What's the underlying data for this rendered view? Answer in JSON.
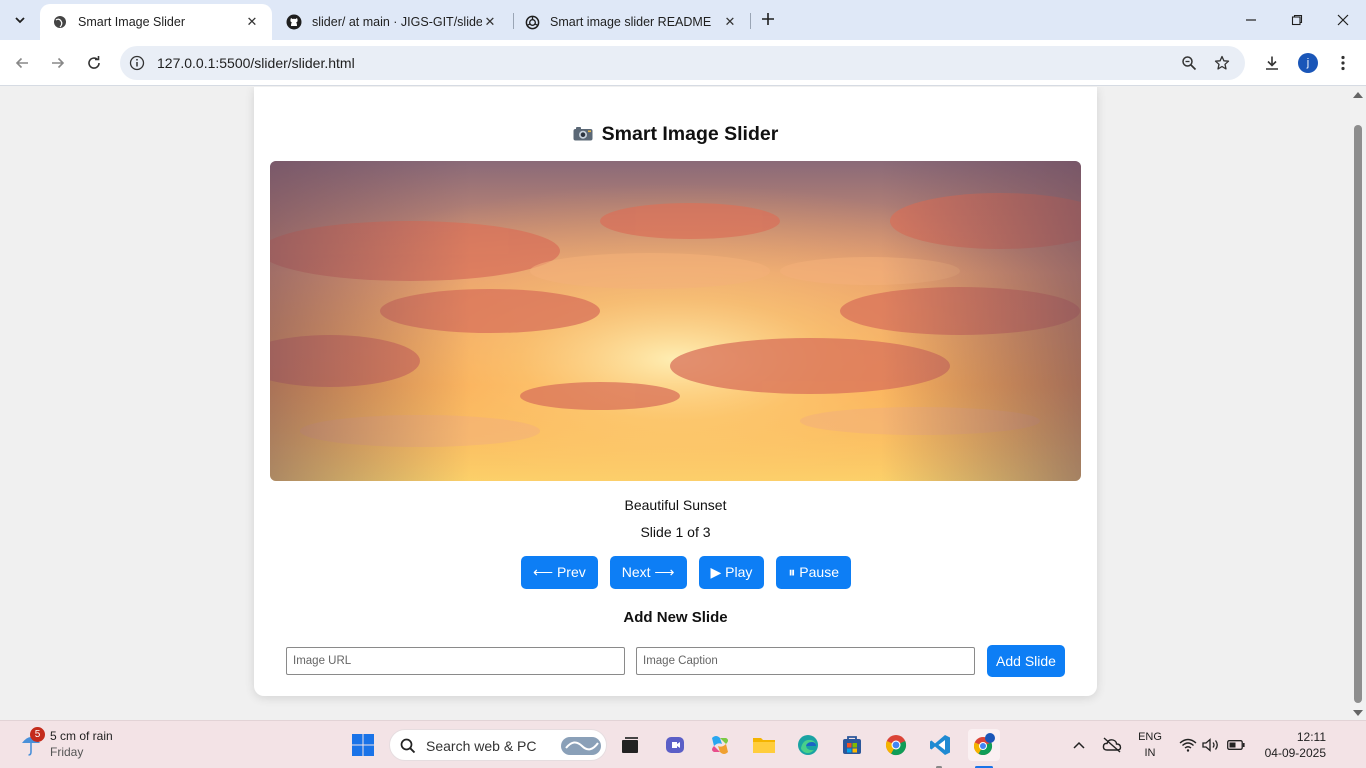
{
  "browser": {
    "tabs": [
      {
        "title": "Smart Image Slider",
        "active": true,
        "icon": "globe-icon"
      },
      {
        "title": "slider/ at main · JIGS-GIT/slider",
        "active": false,
        "icon": "github-icon"
      },
      {
        "title": "Smart image slider README",
        "active": false,
        "icon": "chatgpt-icon"
      }
    ],
    "url": "127.0.0.1:5500/slider/slider.html",
    "profile_initial": "j"
  },
  "page": {
    "title": "Smart Image Slider",
    "caption": "Beautiful Sunset",
    "counter": "Slide 1 of 3",
    "buttons": {
      "prev": "⟵ Prev",
      "next": "Next ⟶",
      "play": "▶ Play",
      "pause": "⏸ Pause"
    },
    "add_section_title": "Add New Slide",
    "url_placeholder": "Image URL",
    "caption_placeholder": "Image Caption",
    "add_button": "Add Slide"
  },
  "taskbar": {
    "weather_badge": "5",
    "weather_line1": "5 cm of rain",
    "weather_line2": "Friday",
    "search_placeholder": "Search web & PC",
    "lang_line1": "ENG",
    "lang_line2": "IN",
    "time": "12:11",
    "date": "04-09-2025"
  },
  "colors": {
    "accent": "#0d7ef5",
    "tabstrip": "#dfe8f7",
    "taskbar": "#f3e3e6"
  }
}
